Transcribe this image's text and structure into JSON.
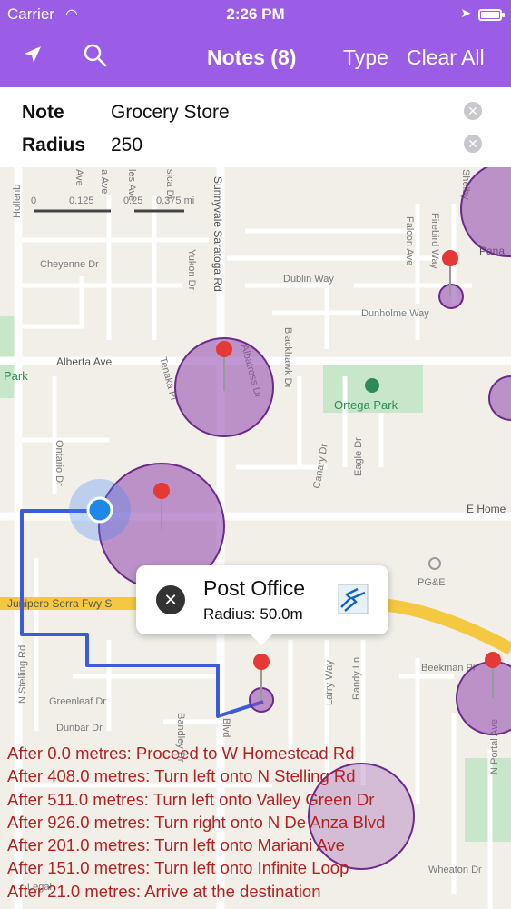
{
  "status": {
    "carrier": "Carrier",
    "time": "2:26 PM"
  },
  "nav": {
    "title": "Notes (8)",
    "type_label": "Type",
    "clear_label": "Clear All"
  },
  "form": {
    "note_label": "Note",
    "note_value": "Grocery Store",
    "radius_label": "Radius",
    "radius_value": "250"
  },
  "map": {
    "scale": [
      "0",
      "0.125",
      "0.25",
      "0.375 mi"
    ],
    "streets": {
      "hollenbeck": "Hollenb",
      "cheyenne": "Cheyenne Dr",
      "alberta": "Alberta Ave",
      "sunnyvale_saratoga": "Sunnyvale Saratoga Rd",
      "yukon": "Yukon Dr",
      "dublin": "Dublin Way",
      "dunholme": "Dunholme Way",
      "falcon": "Falcon Ave",
      "firebird": "Firebird Way",
      "blackhawk": "Blackhawk Dr",
      "albatross": "Albatross Dr",
      "tenaka": "Tenaka Pl",
      "ontario": "Ontario Dr",
      "canary": "Canary Dr",
      "eagle": "Eagle Dr",
      "e_home": "E Home",
      "junipero": "Junipero Serra Fwy S",
      "n_stelling": "N Stelling Rd",
      "greenleaf": "Greenleaf Dr",
      "dunbar": "Dunbar Dr",
      "bandley": "Bandley Dr",
      "blvd": "Blvd",
      "larry": "Larry Way",
      "randy": "Randy Ln",
      "beekman": "Beekman Pl",
      "wheaton": "Wheaton Dr",
      "n_portal": "N Portal Ave",
      "pge": "PG&E",
      "park_left": "Park",
      "panama": "Pana",
      "legal": "Legal",
      "top_a": "a Ave",
      "top_b": "les Ave",
      "top_c": "sica Dr",
      "top_d": "Ave",
      "shelby": "Shelby"
    },
    "ortega_park": "Ortega Park"
  },
  "callout": {
    "title": "Post Office",
    "subtitle": "Radius: 50.0m"
  },
  "directions": [
    "After 0.0 metres: Proceed to W Homestead Rd",
    "After 408.0 metres: Turn left onto N Stelling Rd",
    "After 511.0 metres: Turn left onto Valley Green Dr",
    "After 926.0 metres: Turn right onto N De Anza Blvd",
    "After 201.0 metres: Turn left onto Mariani Ave",
    "After 151.0 metres: Turn left onto Infinite Loop",
    "After 21.0 metres: Arrive at the destination"
  ],
  "colors": {
    "accent": "#9b5de5",
    "route": "#3b5bdb",
    "geofence": "#8e44ad",
    "directions_text": "#b22222"
  }
}
